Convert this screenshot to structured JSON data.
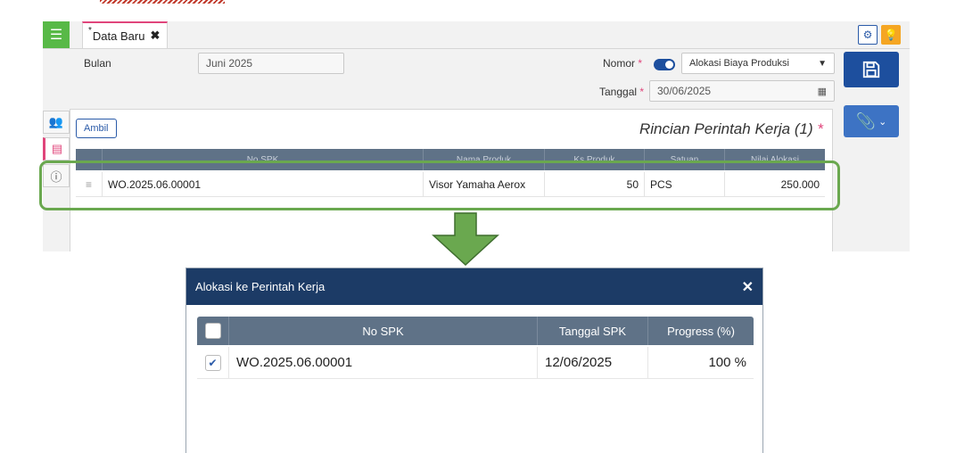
{
  "app": {
    "tab_label": "Data Baru",
    "tab_star": "*",
    "tab_close": "✖",
    "form": {
      "bulan_label": "Bulan",
      "bulan_value": "Juni 2025",
      "nomor_label": "Nomor",
      "nomor_select": "Alokasi Biaya Produksi",
      "tanggal_label": "Tanggal",
      "tanggal_value": "30/06/2025",
      "required_mark": "*"
    },
    "ambil_label": "Ambil",
    "section_title": "Rincian Perintah Kerja (1)",
    "table": {
      "headers": [
        "No SPK",
        "Nama Produk",
        "Ks Produk",
        "Satuan",
        "Nilai Alokasi"
      ],
      "row": {
        "no_spk": "WO.2025.06.00001",
        "nama_produk": "Visor Yamaha Aerox",
        "qty": "50",
        "satuan": "PCS",
        "nilai": "250.000"
      }
    }
  },
  "modal": {
    "title": "Alokasi ke Perintah Kerja",
    "close": "✕",
    "headers": {
      "no_spk": "No SPK",
      "tanggal_spk": "Tanggal SPK",
      "progress": "Progress (%)"
    },
    "row": {
      "checked": true,
      "no_spk": "WO.2025.06.00001",
      "tanggal_spk": "12/06/2025",
      "progress": "100 %"
    }
  },
  "colors": {
    "accent_green": "#58b947",
    "navy": "#1c3b66",
    "table_header": "#5f7287",
    "highlight_outline": "#6aa84f"
  }
}
